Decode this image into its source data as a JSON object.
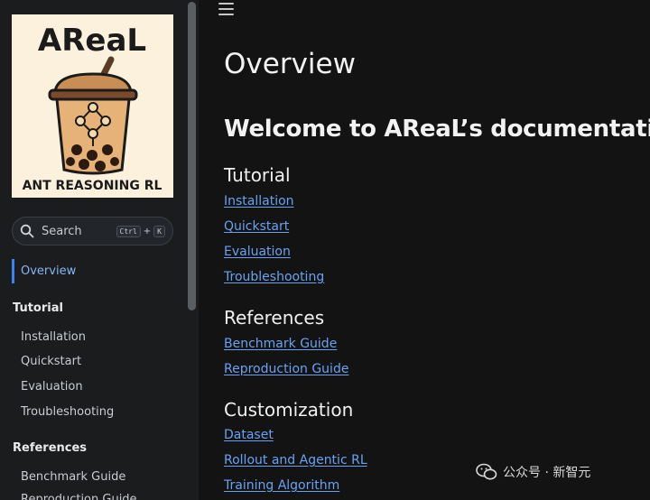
{
  "logo": {
    "title": "AReaL",
    "subtitle": "ANT REASONING RL"
  },
  "search": {
    "placeholder": "Search",
    "shortcut_key1": "Ctrl",
    "shortcut_plus": "+",
    "shortcut_key2": "K",
    "icon": "search-icon"
  },
  "sidebar": {
    "active": "Overview",
    "sections": [
      {
        "title": "Tutorial",
        "items": [
          "Installation",
          "Quickstart",
          "Evaluation",
          "Troubleshooting"
        ]
      },
      {
        "title": "References",
        "items": [
          "Benchmark Guide",
          "Reproduction Guide"
        ]
      }
    ]
  },
  "main": {
    "menu_icon": "hamburger-menu-icon",
    "page_title": "Overview",
    "welcome": "Welcome to AReaL’s documentation!",
    "sections": [
      {
        "title": "Tutorial",
        "links": [
          "Installation",
          "Quickstart",
          "Evaluation",
          "Troubleshooting"
        ]
      },
      {
        "title": "References",
        "links": [
          "Benchmark Guide",
          "Reproduction Guide"
        ]
      },
      {
        "title": "Customization",
        "links": [
          "Dataset",
          "Rollout and Agentic RL",
          "Training Algorithm"
        ]
      }
    ]
  },
  "watermark": {
    "text": "公众号 · 新智元",
    "icon": "wechat-icon"
  },
  "colors": {
    "accent": "#3b82f6",
    "link": "#6aa2f2",
    "sidebar_bg": "#1a1c1e",
    "main_bg": "#131313"
  }
}
